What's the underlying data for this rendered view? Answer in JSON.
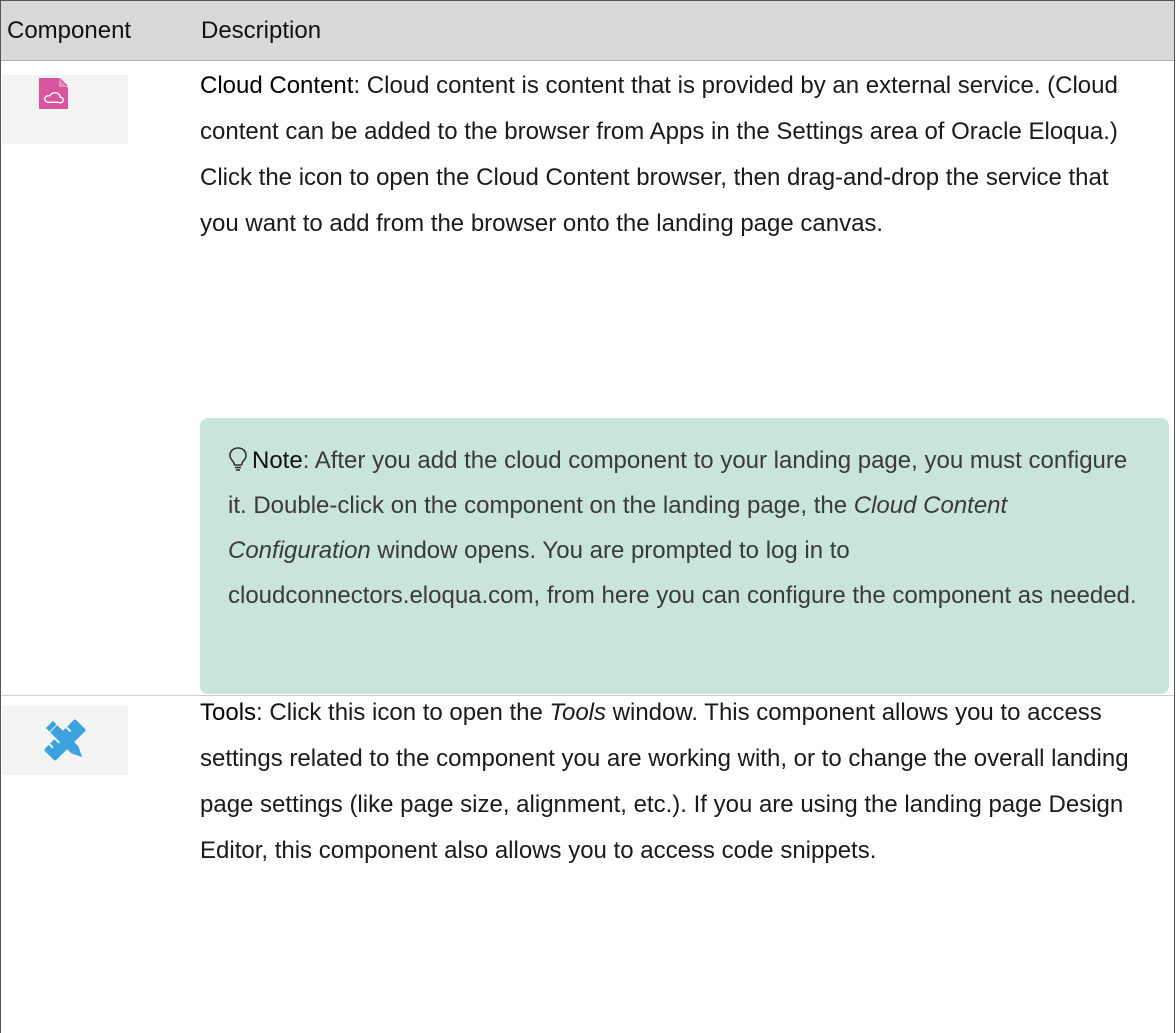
{
  "header": {
    "component": "Component",
    "description": "Description"
  },
  "rows": [
    {
      "icon": "cloud-content-icon",
      "term": "Cloud Content",
      "text": ": Cloud content is content that is provided by an external service. (Cloud content can be added to the browser from Apps in the Settings area of Oracle Eloqua.) Click the icon to open the Cloud Content browser, then drag-and-drop the service that you want to add from the browser onto the landing page canvas.",
      "note": {
        "label": "Note",
        "text_before": ": After you add the cloud component to your landing page, you must configure it. Double-click on the component on the landing page, the ",
        "italic": "Cloud Content Configuration",
        "text_after": " window opens. You are prompted to log in to cloudconnectors.eloqua.com, from here you can configure the component as needed."
      }
    },
    {
      "icon": "tools-icon",
      "term": "Tools",
      "text_before": ": Click this icon to open the ",
      "italic": "Tools",
      "text_after": " window. This component allows you to access settings related to the component you are working with, or to change the overall landing page settings (like page size, alignment, etc.). If you are using the landing page Design Editor, this component also allows you to access code snippets."
    }
  ],
  "colors": {
    "header_bg": "#d9d9d9",
    "note_bg": "#c8e4dc",
    "cloud_icon": "#d9559e",
    "tools_icon": "#3ba2de"
  }
}
